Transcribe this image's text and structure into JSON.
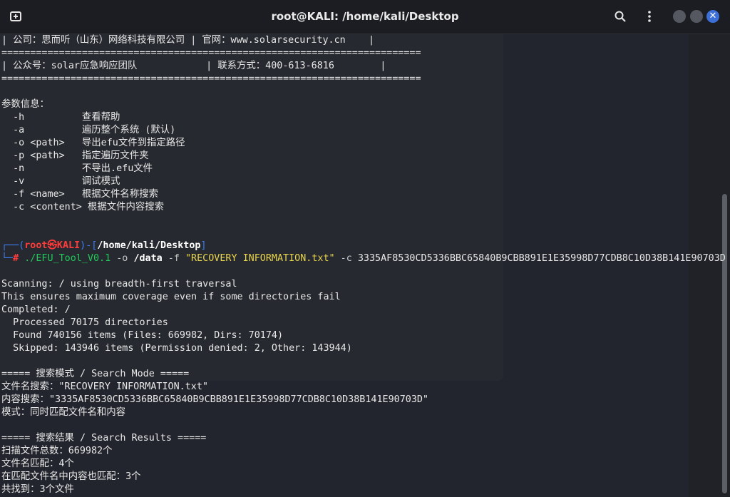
{
  "window": {
    "title": "root@KALI: /home/kali/Desktop"
  },
  "icons": {
    "new_tab": "new-tab-icon",
    "search": "search-icon",
    "menu": "kebab-menu-icon",
    "close": "✕"
  },
  "colors": {
    "prompt_blue": "#3d7ef5",
    "prompt_red": "#ff3b3b",
    "command_green": "#22c95a",
    "string_yellow": "#e8d44d",
    "close_button": "#3d6fd8"
  },
  "banner": {
    "company_row": "| 公司：思而听（山东）网络科技有限公司 | 官网：www.solarsecurity.cn    |",
    "sep1": "=========================================================================",
    "public_row": "| 公众号：solar应急响应团队            | 联系方式：400-613-6816        |",
    "sep2": "========================================================================="
  },
  "help": {
    "heading": "参数信息：",
    "options": [
      {
        "flag": "  -h          ",
        "desc": "查看帮助"
      },
      {
        "flag": "  -a          ",
        "desc": "遍历整个系统 (默认)"
      },
      {
        "flag": "  -o <path>   ",
        "desc": "导出efu文件到指定路径"
      },
      {
        "flag": "  -p <path>   ",
        "desc": "指定遍历文件夹"
      },
      {
        "flag": "  -n          ",
        "desc": "不导出.efu文件"
      },
      {
        "flag": "  -v          ",
        "desc": "调试模式"
      },
      {
        "flag": "  -f <name>   ",
        "desc": "根据文件名称搜索"
      },
      {
        "flag": "  -c <content>",
        "desc": " 根据文件内容搜索"
      }
    ]
  },
  "prompt": {
    "open": "┌──(",
    "user": "root㉿KALI",
    "mid": ")-[",
    "path": "/home/kali/Desktop",
    "close": "]",
    "line2": "└─",
    "hash": "# ",
    "cmd": "./EFU_Tool_V0.1",
    "opt_o": " -o ",
    "arg_o": "/data",
    "opt_f": " -f ",
    "arg_f": "\"RECOVERY INFORMATION.txt\"",
    "opt_c": " -c ",
    "arg_c": "3335AF8530CD5336BBC65840B9CBB891E1E35998D77CDB8C10D38B141E90703D"
  },
  "output": {
    "l1": "Scanning: / using breadth-first traversal",
    "l2": "This ensures maximum coverage even if some directories fail",
    "l3": "Completed: /",
    "l4": "  Processed 70175 directories",
    "l5": "  Found 740156 items (Files: 669982, Dirs: 70174)",
    "l6": "  Skipped: 143946 items (Permission denied: 2, Other: 143944)",
    "mode_header": "===== 搜索模式 / Search Mode =====",
    "mode_name": "文件名搜索：\"RECOVERY INFORMATION.txt\"",
    "mode_content": "内容搜索：\"3335AF8530CD5336BBC65840B9CBB891E1E35998D77CDB8C10D38B141E90703D\"",
    "mode_mode": "模式：同时匹配文件名和内容",
    "result_header": "===== 搜索结果 / Search Results =====",
    "r1": "扫描文件总数：669982个",
    "r2": "文件名匹配：4个",
    "r3": "在匹配文件名中内容也匹配：3个",
    "r4": "共找到：3个文件"
  }
}
